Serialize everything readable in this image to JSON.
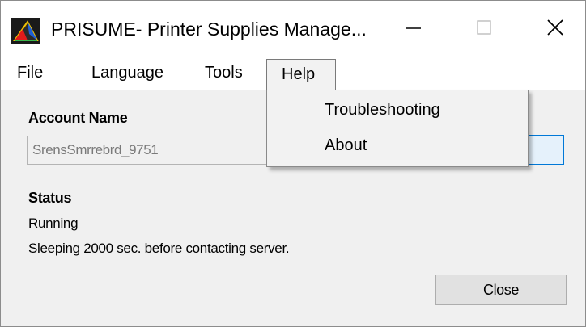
{
  "window": {
    "title": "PRISUME- Printer Supplies Manage...",
    "controls": {
      "minimize_icon": "minimize-icon",
      "maximize_icon": "maximize-icon",
      "close_icon": "close-icon"
    }
  },
  "menubar": {
    "items": [
      {
        "label": "File"
      },
      {
        "label": "Language"
      },
      {
        "label": "Tools"
      },
      {
        "label": "Help"
      }
    ]
  },
  "help_menu": {
    "items": [
      {
        "label": "Troubleshooting"
      },
      {
        "label": "About"
      }
    ]
  },
  "account": {
    "label": "Account Name",
    "value": "SrensSmrrebrd_9751"
  },
  "status": {
    "label": "Status",
    "state": "Running",
    "message": "Sleeping 2000 sec. before contacting server."
  },
  "buttons": {
    "close_label": "Close"
  },
  "colors": {
    "focus_border": "#0078d7",
    "window_bg": "#f0f0f0",
    "menu_bg": "#f2f2f2"
  }
}
